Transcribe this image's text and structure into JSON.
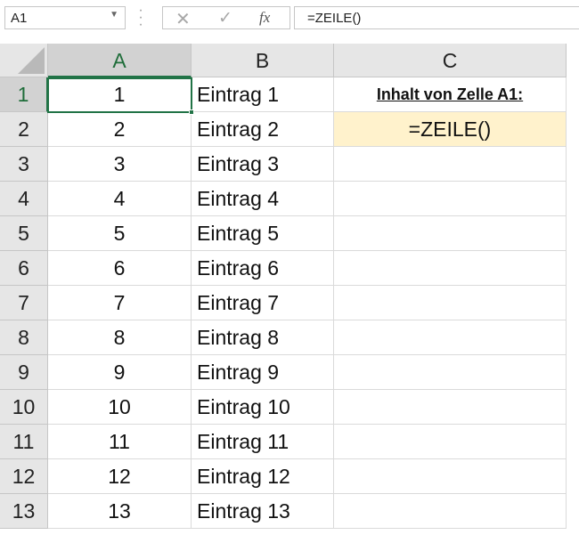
{
  "formula_bar": {
    "name_box": "A1",
    "cancel_icon": "✕",
    "enter_icon": "✓",
    "fx_label": "fx",
    "formula": "=ZEILE()"
  },
  "columns": [
    "A",
    "B",
    "C"
  ],
  "selected_cell": "A1",
  "rows": [
    {
      "num": "1",
      "a": "1",
      "b": "Eintrag 1",
      "c": "Inhalt von Zelle A1:"
    },
    {
      "num": "2",
      "a": "2",
      "b": "Eintrag 2",
      "c": "=ZEILE()"
    },
    {
      "num": "3",
      "a": "3",
      "b": "Eintrag 3",
      "c": ""
    },
    {
      "num": "4",
      "a": "4",
      "b": "Eintrag 4",
      "c": ""
    },
    {
      "num": "5",
      "a": "5",
      "b": "Eintrag 5",
      "c": ""
    },
    {
      "num": "6",
      "a": "6",
      "b": "Eintrag 6",
      "c": ""
    },
    {
      "num": "7",
      "a": "7",
      "b": "Eintrag 7",
      "c": ""
    },
    {
      "num": "8",
      "a": "8",
      "b": "Eintrag 8",
      "c": ""
    },
    {
      "num": "9",
      "a": "9",
      "b": "Eintrag 9",
      "c": ""
    },
    {
      "num": "10",
      "a": "10",
      "b": "Eintrag 10",
      "c": ""
    },
    {
      "num": "11",
      "a": "11",
      "b": "Eintrag 11",
      "c": ""
    },
    {
      "num": "12",
      "a": "12",
      "b": "Eintrag 12",
      "c": ""
    },
    {
      "num": "13",
      "a": "13",
      "b": "Eintrag 13",
      "c": ""
    }
  ],
  "colors": {
    "accent": "#217346",
    "highlight": "#fff2cc"
  }
}
